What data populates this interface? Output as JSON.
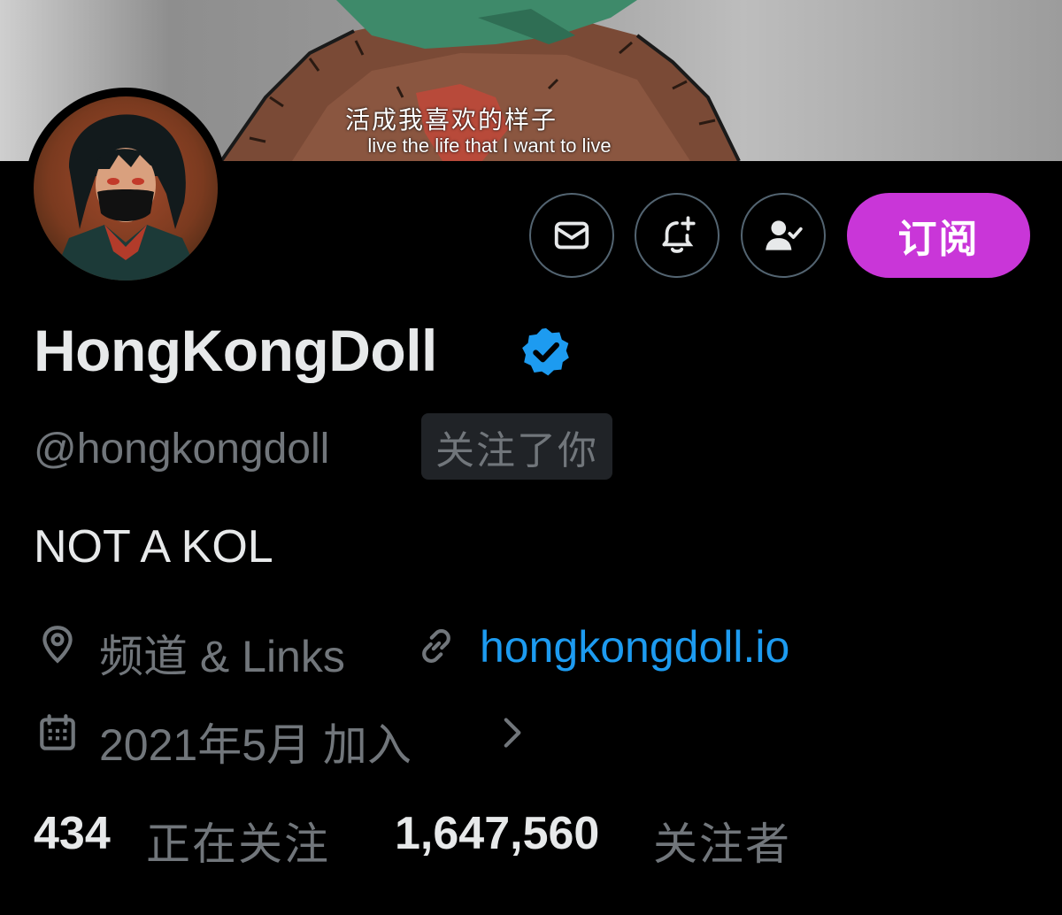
{
  "banner": {
    "caption_cn": "活成我喜欢的样子",
    "caption_en": "live the life that I want to live"
  },
  "actions": {
    "message_icon": "mail-icon",
    "notify_icon": "bell-plus-icon",
    "following_icon": "person-check-icon",
    "subscribe_label": "订阅"
  },
  "profile": {
    "display_name": "HongKongDoll",
    "verified": true,
    "handle": "@hongkongdoll",
    "follows_you_label": "关注了你",
    "bio": "NOT A KOL",
    "location": "频道 & Links",
    "website": "hongkongdoll.io",
    "joined": "2021年5月 加入",
    "following_count": "434",
    "following_label": "正在关注",
    "followers_count": "1,647,560",
    "followers_label": "关注者"
  },
  "colors": {
    "accent_subscribe": "#c936d8",
    "verified_blue": "#1d9bf0",
    "muted_text": "#71767b",
    "border": "#536471"
  }
}
